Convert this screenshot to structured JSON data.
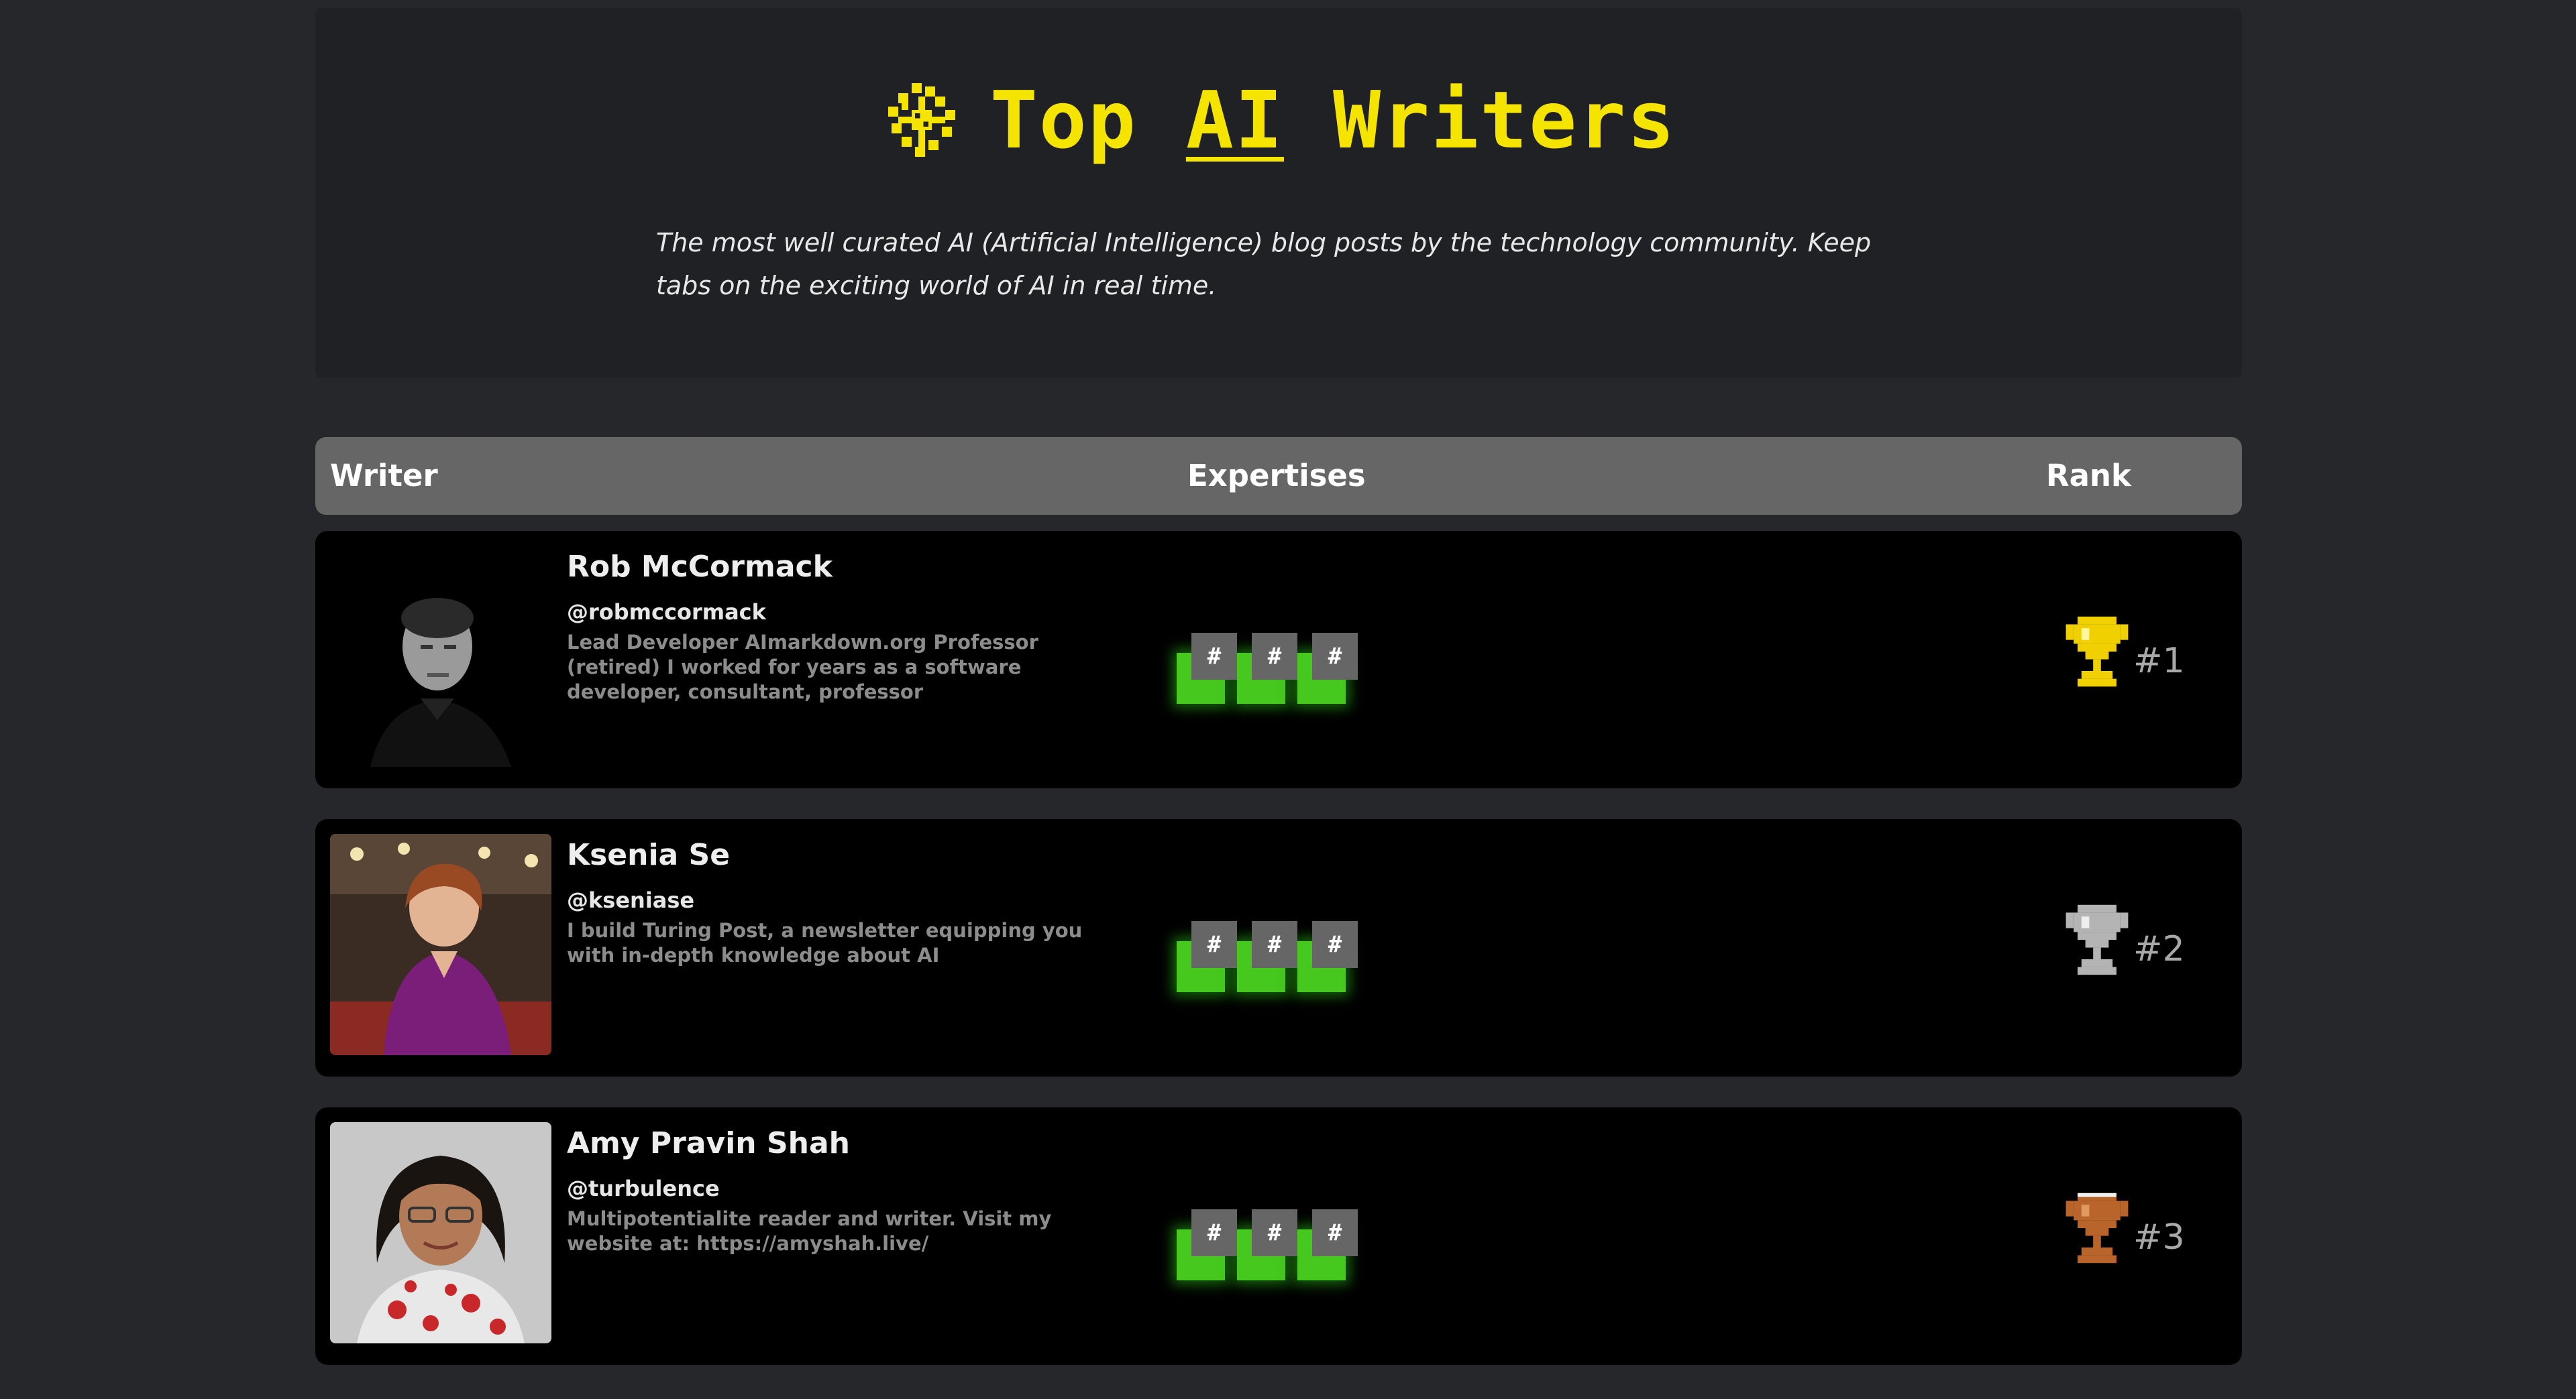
{
  "header": {
    "title_prefix": "Top ",
    "title_ai": "AI",
    "title_suffix": " Writers",
    "tagline": "The most well curated AI (Artificial Intelligence) blog posts by the technology community. Keep tabs on the exciting world of AI in real time.",
    "logo_icon": "brain-icon",
    "accent_color": "#f5e400"
  },
  "table": {
    "columns": {
      "writer": "Writer",
      "expertises": "Expertises",
      "rank": "Rank"
    },
    "tag_symbol": "#",
    "tag_glow_color": "#46c81e",
    "rows": [
      {
        "name": "Rob McCormack",
        "handle": "@robmccormack",
        "bio": "Lead Developer AImarkdown.org Professor (retired) I worked for years as a software developer, consultant, professor",
        "rank": "#1",
        "trophy": "gold-trophy-icon",
        "trophy_color": "#f0d000"
      },
      {
        "name": "Ksenia Se",
        "handle": "@kseniase",
        "bio": "I build Turing Post, a newsletter equipping you with in-depth knowledge about AI",
        "rank": "#2",
        "trophy": "silver-trophy-icon",
        "trophy_color": "#b4b4b4"
      },
      {
        "name": "Amy Pravin Shah",
        "handle": "@turbulence",
        "bio": "Multipotentialite reader and writer. Visit my website at: https://amyshah.live/",
        "rank": "#3",
        "trophy": "bronze-trophy-icon",
        "trophy_color": "#b8642a"
      }
    ]
  }
}
